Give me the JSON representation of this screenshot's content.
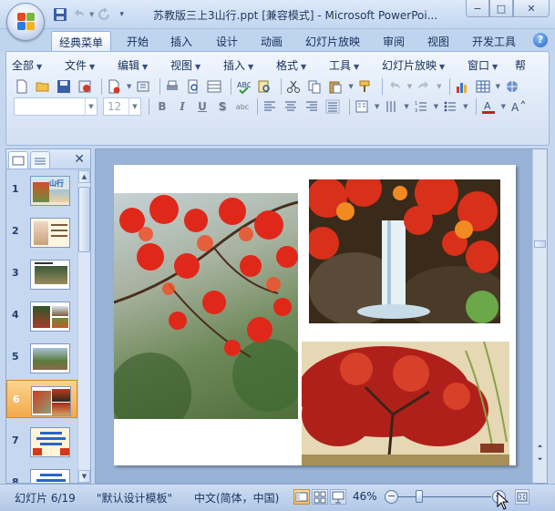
{
  "window": {
    "title": "苏教版三上3山行.ppt [兼容模式] - Microsoft PowerPoi...",
    "controls": {
      "minimize": "−",
      "maximize": "□",
      "close": "✕"
    }
  },
  "ribbon_tabs": [
    {
      "label": "经典菜单",
      "active": true
    },
    {
      "label": "开始"
    },
    {
      "label": "插入"
    },
    {
      "label": "设计"
    },
    {
      "label": "动画"
    },
    {
      "label": "幻灯片放映"
    },
    {
      "label": "审阅"
    },
    {
      "label": "视图"
    },
    {
      "label": "开发工具"
    }
  ],
  "menus": [
    "全部",
    "文件",
    "编辑",
    "视图",
    "插入",
    "格式",
    "工具",
    "幻灯片放映",
    "窗口",
    "帮"
  ],
  "format_bar": {
    "font_name": "",
    "font_size": "12",
    "bold": "B",
    "italic": "I",
    "underline": "U",
    "shadow": "S",
    "spacing": "abc"
  },
  "pane": {
    "close": "✕",
    "slides": [
      {
        "number": "1",
        "selected": false
      },
      {
        "number": "2",
        "selected": false
      },
      {
        "number": "3",
        "selected": false
      },
      {
        "number": "4",
        "selected": false
      },
      {
        "number": "5",
        "selected": false
      },
      {
        "number": "6",
        "selected": true
      },
      {
        "number": "7",
        "selected": false
      },
      {
        "number": "8",
        "selected": false
      }
    ],
    "thumb1_title": "山行"
  },
  "status": {
    "slide_counter": "幻灯片 6/19",
    "template": "\"默认设计模板\"",
    "language": "中文(简体，中国)",
    "zoom": "46%",
    "zoom_level_percent": 46
  },
  "icons": {
    "office": "office-logo-icon",
    "help": "?"
  }
}
